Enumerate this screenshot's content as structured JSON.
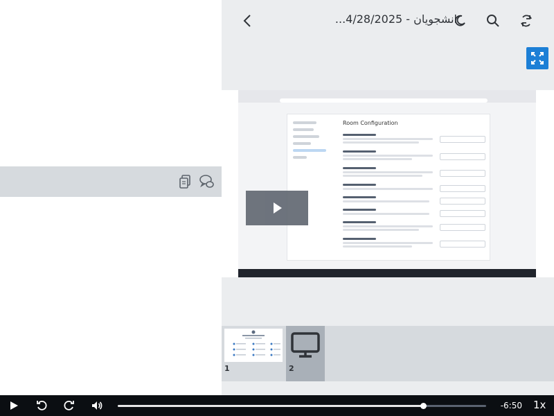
{
  "header": {
    "title": "...انشجويان - 4/28/2025",
    "icons": {
      "back": "chevron-left-icon",
      "theme": "moon-icon",
      "search": "search-icon",
      "sync": "sync-icon",
      "expand": "expand-icon"
    }
  },
  "chat_strip": {
    "icons": {
      "copy": "copy-icon",
      "chat": "chat-bubbles-icon"
    }
  },
  "slide_preview": {
    "heading": "Room Configuration"
  },
  "thumbnails": [
    {
      "number": "1",
      "kind": "slide"
    },
    {
      "number": "2",
      "kind": "screen-share"
    }
  ],
  "player": {
    "time_remaining": "-6:50",
    "speed": "1x",
    "progress": 0.83,
    "icons": {
      "play": "play-icon",
      "rewind": "rewind-icon",
      "forward": "forward-icon",
      "volume": "volume-icon"
    }
  },
  "colors": {
    "accent": "#1c7fd6",
    "player_bg": "#0b0e12",
    "strip_bg": "#d6dade"
  }
}
